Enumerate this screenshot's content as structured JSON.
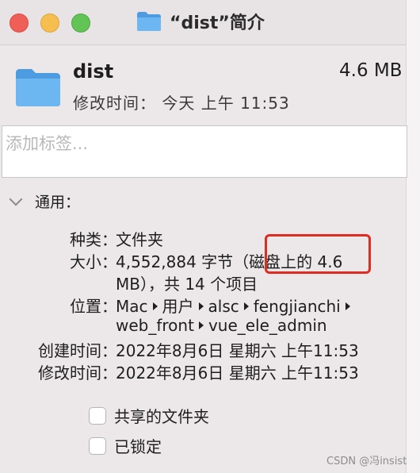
{
  "window": {
    "title": "“dist”简介"
  },
  "header": {
    "name": "dist",
    "size": "4.6 MB",
    "modified_summary": "修改时间： 今天 上午 11:53"
  },
  "tags": {
    "placeholder": "添加标签..."
  },
  "general": {
    "section_label": "通用：",
    "kind_label": "种类：",
    "kind_value": "文件夹",
    "size_label": "大小：",
    "size_value_line1": "4,552,884 字节（磁盘上的 4.6",
    "size_value_line2": "MB），共 14 个项目",
    "where_label": "位置：",
    "where_path": [
      "Mac",
      "用户",
      "alsc",
      "fengjianchi",
      "web_front",
      "vue_ele_admin"
    ],
    "created_label": "创建时间：",
    "created_value": "2022年8月6日 星期六 上午11:53",
    "modified_label": "修改时间：",
    "modified_value": "2022年8月6日 星期六 上午11:53"
  },
  "options": {
    "shared_folder_label": "共享的文件夹",
    "locked_label": "已锁定"
  },
  "watermark": "CSDN @冯insist",
  "colors": {
    "folder": "#5aa9ea",
    "highlight": "#e02b20"
  }
}
